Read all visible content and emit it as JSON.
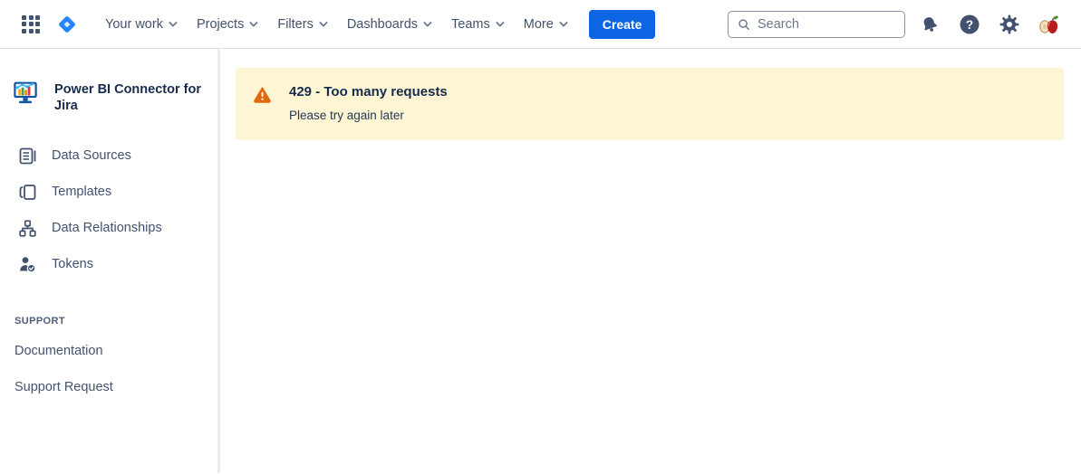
{
  "nav": {
    "items": [
      {
        "label": "Your work"
      },
      {
        "label": "Projects"
      },
      {
        "label": "Filters"
      },
      {
        "label": "Dashboards"
      },
      {
        "label": "Teams"
      },
      {
        "label": "More"
      }
    ],
    "create_label": "Create",
    "search_placeholder": "Search",
    "search_value": "",
    "icons": [
      "app-switcher-icon",
      "jira-logo",
      "notifications-bell-icon",
      "help-icon",
      "settings-gear-icon",
      "user-avatar-apple"
    ]
  },
  "sidebar": {
    "app_title": "Power BI Connector for Jira",
    "app_icon": "monitor-chart-icon",
    "items": [
      {
        "label": "Data Sources",
        "icon": "data-sources-icon"
      },
      {
        "label": "Templates",
        "icon": "templates-icon"
      },
      {
        "label": "Data Relationships",
        "icon": "data-relationships-icon"
      },
      {
        "label": "Tokens",
        "icon": "tokens-icon"
      }
    ],
    "support_heading": "SUPPORT",
    "support_links": [
      {
        "label": "Documentation"
      },
      {
        "label": "Support Request"
      }
    ]
  },
  "main": {
    "banner": {
      "type": "warning",
      "icon": "warning-triangle-icon",
      "title": "429 - Too many requests",
      "message": "Please try again later"
    }
  },
  "colors": {
    "accent_blue": "#0C66E4",
    "jira_logo_blue": "#2684FF",
    "nav_text": "#42526E",
    "heading_text": "#172B4D",
    "banner_background": "#FDF5D4",
    "warning_orange": "#E2690F",
    "divider": "#EBECF0"
  }
}
